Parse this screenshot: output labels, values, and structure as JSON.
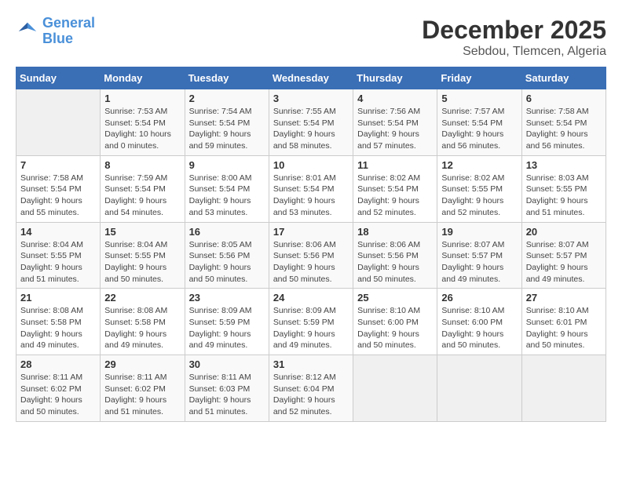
{
  "header": {
    "logo_line1": "General",
    "logo_line2": "Blue",
    "month": "December 2025",
    "location": "Sebdou, Tlemcen, Algeria"
  },
  "days_of_week": [
    "Sunday",
    "Monday",
    "Tuesday",
    "Wednesday",
    "Thursday",
    "Friday",
    "Saturday"
  ],
  "weeks": [
    [
      {
        "day": "",
        "info": ""
      },
      {
        "day": "1",
        "info": "Sunrise: 7:53 AM\nSunset: 5:54 PM\nDaylight: 10 hours\nand 0 minutes."
      },
      {
        "day": "2",
        "info": "Sunrise: 7:54 AM\nSunset: 5:54 PM\nDaylight: 9 hours\nand 59 minutes."
      },
      {
        "day": "3",
        "info": "Sunrise: 7:55 AM\nSunset: 5:54 PM\nDaylight: 9 hours\nand 58 minutes."
      },
      {
        "day": "4",
        "info": "Sunrise: 7:56 AM\nSunset: 5:54 PM\nDaylight: 9 hours\nand 57 minutes."
      },
      {
        "day": "5",
        "info": "Sunrise: 7:57 AM\nSunset: 5:54 PM\nDaylight: 9 hours\nand 56 minutes."
      },
      {
        "day": "6",
        "info": "Sunrise: 7:58 AM\nSunset: 5:54 PM\nDaylight: 9 hours\nand 56 minutes."
      }
    ],
    [
      {
        "day": "7",
        "info": "Sunrise: 7:58 AM\nSunset: 5:54 PM\nDaylight: 9 hours\nand 55 minutes."
      },
      {
        "day": "8",
        "info": "Sunrise: 7:59 AM\nSunset: 5:54 PM\nDaylight: 9 hours\nand 54 minutes."
      },
      {
        "day": "9",
        "info": "Sunrise: 8:00 AM\nSunset: 5:54 PM\nDaylight: 9 hours\nand 53 minutes."
      },
      {
        "day": "10",
        "info": "Sunrise: 8:01 AM\nSunset: 5:54 PM\nDaylight: 9 hours\nand 53 minutes."
      },
      {
        "day": "11",
        "info": "Sunrise: 8:02 AM\nSunset: 5:54 PM\nDaylight: 9 hours\nand 52 minutes."
      },
      {
        "day": "12",
        "info": "Sunrise: 8:02 AM\nSunset: 5:55 PM\nDaylight: 9 hours\nand 52 minutes."
      },
      {
        "day": "13",
        "info": "Sunrise: 8:03 AM\nSunset: 5:55 PM\nDaylight: 9 hours\nand 51 minutes."
      }
    ],
    [
      {
        "day": "14",
        "info": "Sunrise: 8:04 AM\nSunset: 5:55 PM\nDaylight: 9 hours\nand 51 minutes."
      },
      {
        "day": "15",
        "info": "Sunrise: 8:04 AM\nSunset: 5:55 PM\nDaylight: 9 hours\nand 50 minutes."
      },
      {
        "day": "16",
        "info": "Sunrise: 8:05 AM\nSunset: 5:56 PM\nDaylight: 9 hours\nand 50 minutes."
      },
      {
        "day": "17",
        "info": "Sunrise: 8:06 AM\nSunset: 5:56 PM\nDaylight: 9 hours\nand 50 minutes."
      },
      {
        "day": "18",
        "info": "Sunrise: 8:06 AM\nSunset: 5:56 PM\nDaylight: 9 hours\nand 50 minutes."
      },
      {
        "day": "19",
        "info": "Sunrise: 8:07 AM\nSunset: 5:57 PM\nDaylight: 9 hours\nand 49 minutes."
      },
      {
        "day": "20",
        "info": "Sunrise: 8:07 AM\nSunset: 5:57 PM\nDaylight: 9 hours\nand 49 minutes."
      }
    ],
    [
      {
        "day": "21",
        "info": "Sunrise: 8:08 AM\nSunset: 5:58 PM\nDaylight: 9 hours\nand 49 minutes."
      },
      {
        "day": "22",
        "info": "Sunrise: 8:08 AM\nSunset: 5:58 PM\nDaylight: 9 hours\nand 49 minutes."
      },
      {
        "day": "23",
        "info": "Sunrise: 8:09 AM\nSunset: 5:59 PM\nDaylight: 9 hours\nand 49 minutes."
      },
      {
        "day": "24",
        "info": "Sunrise: 8:09 AM\nSunset: 5:59 PM\nDaylight: 9 hours\nand 49 minutes."
      },
      {
        "day": "25",
        "info": "Sunrise: 8:10 AM\nSunset: 6:00 PM\nDaylight: 9 hours\nand 50 minutes."
      },
      {
        "day": "26",
        "info": "Sunrise: 8:10 AM\nSunset: 6:00 PM\nDaylight: 9 hours\nand 50 minutes."
      },
      {
        "day": "27",
        "info": "Sunrise: 8:10 AM\nSunset: 6:01 PM\nDaylight: 9 hours\nand 50 minutes."
      }
    ],
    [
      {
        "day": "28",
        "info": "Sunrise: 8:11 AM\nSunset: 6:02 PM\nDaylight: 9 hours\nand 50 minutes."
      },
      {
        "day": "29",
        "info": "Sunrise: 8:11 AM\nSunset: 6:02 PM\nDaylight: 9 hours\nand 51 minutes."
      },
      {
        "day": "30",
        "info": "Sunrise: 8:11 AM\nSunset: 6:03 PM\nDaylight: 9 hours\nand 51 minutes."
      },
      {
        "day": "31",
        "info": "Sunrise: 8:12 AM\nSunset: 6:04 PM\nDaylight: 9 hours\nand 52 minutes."
      },
      {
        "day": "",
        "info": ""
      },
      {
        "day": "",
        "info": ""
      },
      {
        "day": "",
        "info": ""
      }
    ]
  ]
}
